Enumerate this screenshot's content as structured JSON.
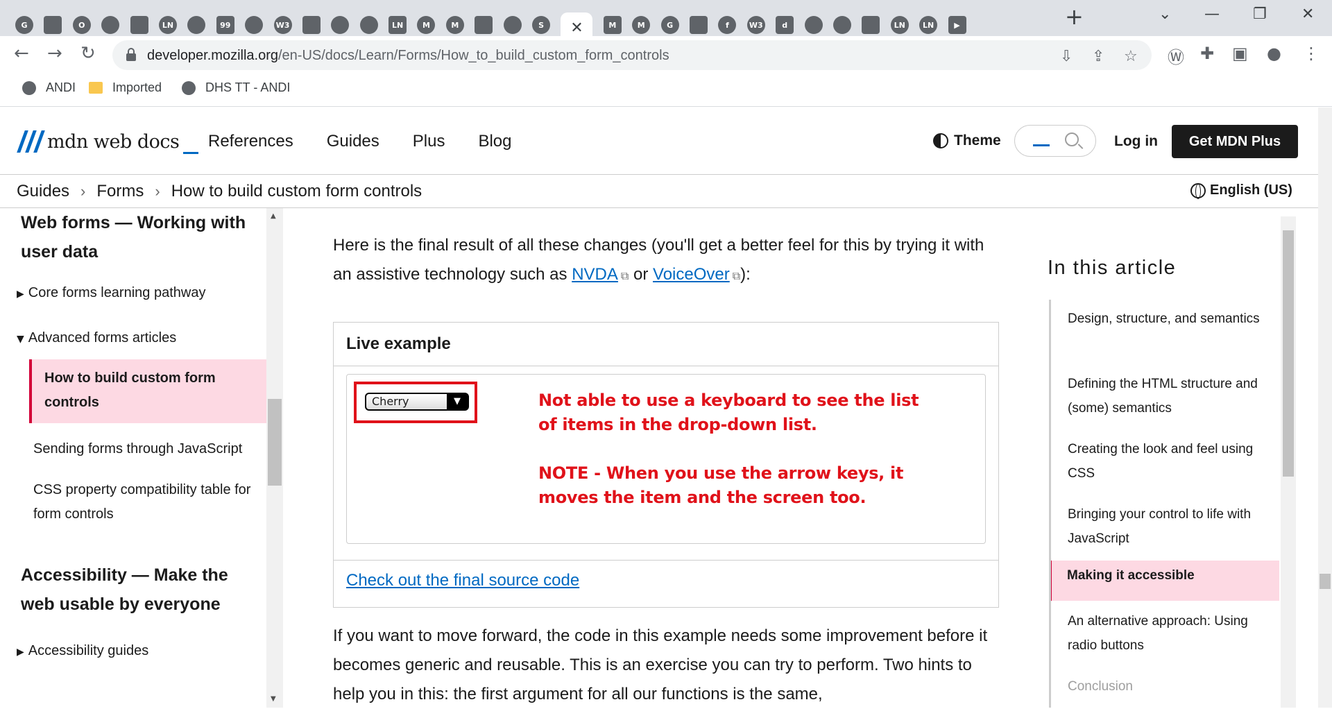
{
  "browser": {
    "tab_icons": [
      "G",
      "",
      "O",
      "",
      "",
      "LN",
      "",
      "99",
      "",
      "W3",
      "",
      "",
      "",
      "LN",
      "M",
      "M",
      "",
      "",
      "S",
      "M",
      "M",
      "G",
      "",
      "f",
      "W3",
      "d",
      "",
      "",
      "",
      "LN",
      "LN",
      "▶"
    ],
    "active_tab_close": "✕",
    "new_tab": "+",
    "url_host": "developer.mozilla.org",
    "url_path": "/en-US/docs/Learn/Forms/How_to_build_custom_form_controls",
    "bookmarks": [
      "ANDI",
      "Imported",
      "DHS TT - ANDI"
    ]
  },
  "mdn": {
    "logo_text": "mdn web docs",
    "nav": [
      "References",
      "Guides",
      "Plus",
      "Blog"
    ],
    "theme": "Theme",
    "login": "Log in",
    "get_plus": "Get MDN Plus",
    "breadcrumbs": [
      "Guides",
      "Forms",
      "How to build custom form controls"
    ],
    "language": "English (US)"
  },
  "sidebar": {
    "heading1": "Web forms — Working with user data",
    "core_pathway": "Core forms learning pathway",
    "advanced": "Advanced forms articles",
    "current": "How to build custom form controls",
    "sending": "Sending forms through JavaScript",
    "css_compat": "CSS property compatibility table for form controls",
    "heading2": "Accessibility — Make the web usable by everyone",
    "a11y_guides": "Accessibility guides"
  },
  "content": {
    "intro_before": "Here is the final result of all these changes (you'll get a better feel for this by trying it with an assistive technology such as ",
    "nvda": "NVDA",
    "or": " or ",
    "voiceover": "VoiceOver",
    "intro_after": "):",
    "live_title": "Live example",
    "select_value": "Cherry",
    "note_line1": "Not able to use a keyboard to see the list",
    "note_line2": "of items in the drop-down list.",
    "note_line3": "NOTE - When you use the arrow keys, it",
    "note_line4": "moves the item and the screen too.",
    "source_link": "Check out the final source code",
    "para2": "If you want to move forward, the code in this example needs some improvement before it becomes generic and reusable. This is an exercise you can try to perform. Two hints to help you in this: the first argument for all our functions is the same,"
  },
  "toc": {
    "title": "In this article",
    "items": [
      "Design, structure, and semantics",
      "Defining the HTML structure and (some) semantics",
      "Creating the look and feel using CSS",
      "Bringing your control to life with JavaScript",
      "Making it accessible",
      "An alternative approach: Using radio buttons",
      "Conclusion"
    ]
  },
  "colors": {
    "accent": "#0069c2",
    "current": "#fdd9e3",
    "current_border": "#d30038",
    "note": "#e0121a"
  }
}
